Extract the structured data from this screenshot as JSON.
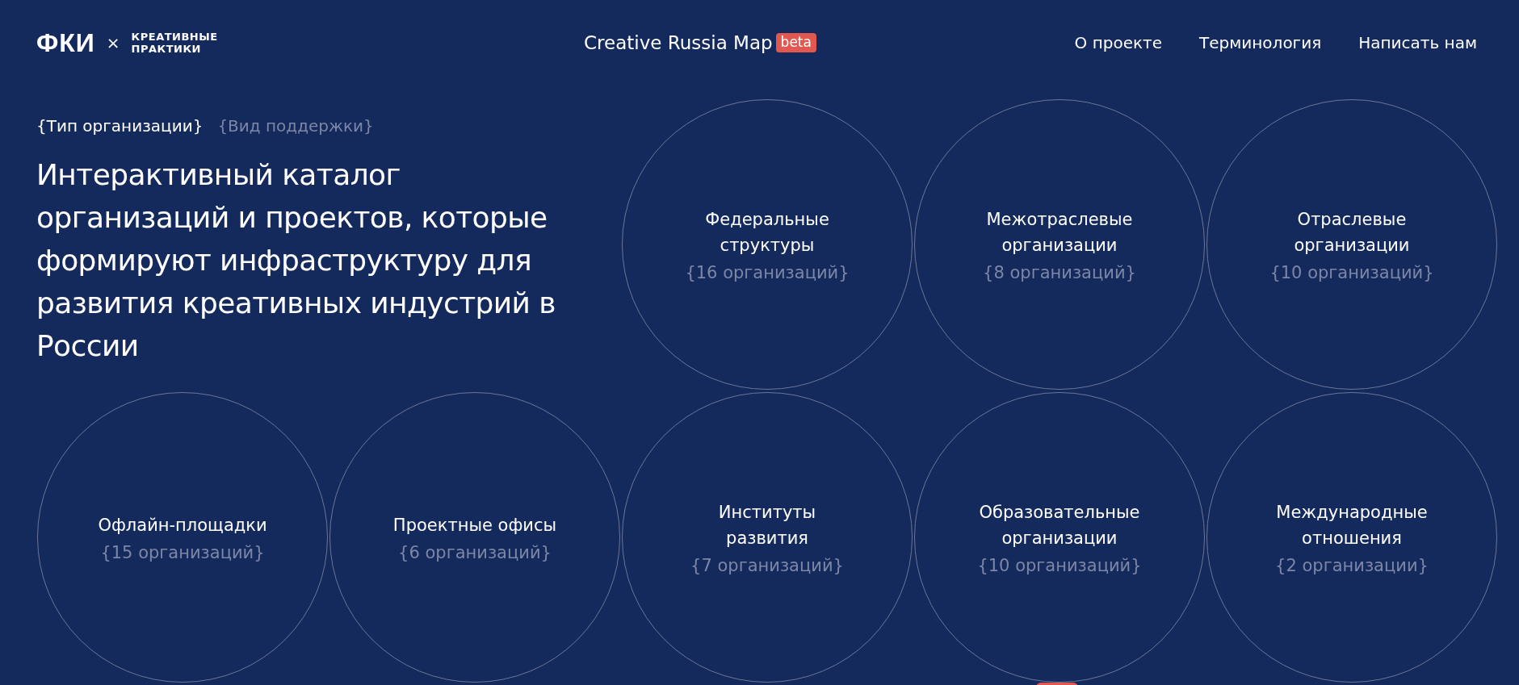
{
  "header": {
    "logo": {
      "mark": "ФКИ",
      "separator": "×",
      "partner": [
        "КРЕАТИВНЫЕ",
        "ПРАКТИКИ"
      ]
    },
    "title": "Creative Russia Map",
    "badge": "beta",
    "nav": [
      "О проекте",
      "Терминология",
      "Написать нам"
    ]
  },
  "filters": [
    {
      "label": "{Тип организации}",
      "selected": true
    },
    {
      "label": "{Вид поддержки}",
      "selected": false
    }
  ],
  "headline": "Интерактивный каталог организаций и проектов, которые формируют инфраструктуру для развития креативных индустрий в России",
  "categories": [
    {
      "title": "Федеральные\nструктуры",
      "count": "{16 организаций}"
    },
    {
      "title": "Межотраслевые\nорганизации",
      "count": "{8 организаций}"
    },
    {
      "title": "Отраслевые\nорганизации",
      "count": "{10 организаций}"
    },
    {
      "title": "Офлайн-площадки",
      "count": "{15 организаций}"
    },
    {
      "title": "Проектные офисы",
      "count": "{6 организаций}"
    },
    {
      "title": "Институты\nразвития",
      "count": "{7 организаций}"
    },
    {
      "title": "Образовательные\nорганизации",
      "count": "{10 организаций}"
    },
    {
      "title": "Международные\nотношения",
      "count": "{2 организации}"
    }
  ]
}
